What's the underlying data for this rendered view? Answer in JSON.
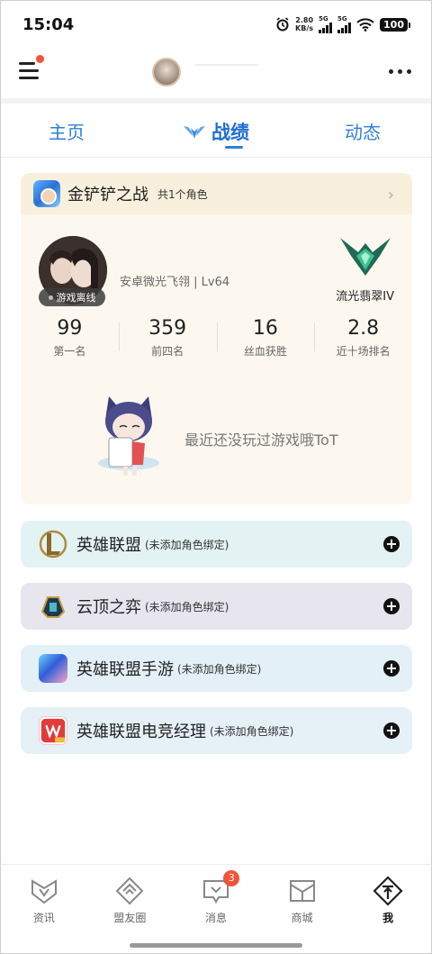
{
  "status_bar": {
    "time": "15:04",
    "speed_value": "2.80",
    "speed_unit": "KB/s",
    "signal1_label": "5G",
    "signal2_label": "5G",
    "battery": "100"
  },
  "header": {
    "menu_icon": "hamburger-menu-icon",
    "more_icon": "more-dots-icon"
  },
  "tabs": {
    "home": "主页",
    "record": "战绩",
    "dynamic": "动态"
  },
  "tft_card": {
    "title": "金铲铲之战",
    "subtitle": "共1个角色",
    "status": "游戏离线",
    "info": "安卓微光飞翎 | Lv64",
    "rank": "流光翡翠IV",
    "stats": [
      {
        "value": "99",
        "label": "第一名"
      },
      {
        "value": "359",
        "label": "前四名"
      },
      {
        "value": "16",
        "label": "丝血获胜"
      },
      {
        "value": "2.8",
        "label": "近十场排名"
      }
    ],
    "empty_message": "最近还没玩过游戏哦ToT"
  },
  "games": [
    {
      "name": "英雄联盟",
      "note": "(未添加角色绑定)"
    },
    {
      "name": "云顶之弈",
      "note": "(未添加角色绑定)"
    },
    {
      "name": "英雄联盟手游",
      "note": "(未添加角色绑定)"
    },
    {
      "name": "英雄联盟电竞经理",
      "note": "(未添加角色绑定)"
    }
  ],
  "bottom_nav": {
    "news": "资讯",
    "friends": "盟友圈",
    "messages": "消息",
    "messages_badge": "3",
    "shop": "商城",
    "me": "我"
  },
  "colors": {
    "accent": "#2f7fd9",
    "badge": "#f0533a"
  }
}
